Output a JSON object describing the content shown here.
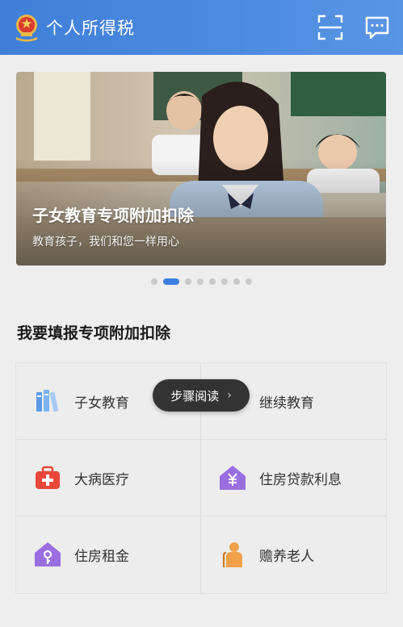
{
  "header": {
    "title": "个人所得税",
    "emblem_icon": "national-emblem-icon",
    "scan_icon": "scan-icon",
    "message_icon": "message-icon"
  },
  "banner": {
    "title": "子女教育专项附加扣除",
    "subtitle": "教育孩子，我们和您一样用心",
    "page_count": 8,
    "active_page": 2
  },
  "section": {
    "title": "我要填报专项附加扣除"
  },
  "items": [
    {
      "label": "子女教育",
      "icon": "books-icon",
      "color": "#5b9be8"
    },
    {
      "label": "继续教育",
      "icon": "graduation-icon",
      "color": "#f0a14a"
    },
    {
      "label": "大病医疗",
      "icon": "medical-kit-icon",
      "color": "#e8483a"
    },
    {
      "label": "住房贷款利息",
      "icon": "house-yen-icon",
      "color": "#9a6ee0"
    },
    {
      "label": "住房租金",
      "icon": "house-key-icon",
      "color": "#9a6ee0"
    },
    {
      "label": "赡养老人",
      "icon": "elderly-icon",
      "color": "#f0a14a"
    }
  ],
  "toast": {
    "label": "步骤阅读",
    "chevron": "›"
  }
}
